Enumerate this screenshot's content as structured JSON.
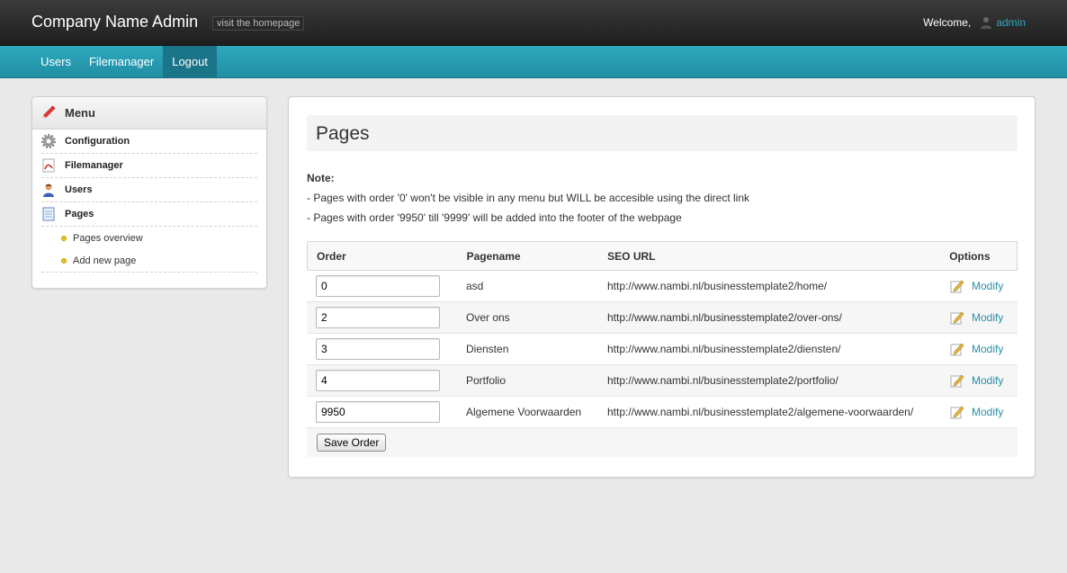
{
  "header": {
    "brand": "Company Name Admin",
    "visit_label": "visit the homepage",
    "welcome_text": "Welcome,",
    "username": "admin"
  },
  "nav": {
    "items": [
      {
        "label": "Users"
      },
      {
        "label": "Filemanager"
      },
      {
        "label": "Logout"
      }
    ]
  },
  "sidebar": {
    "title": "Menu",
    "items": [
      {
        "label": "Configuration",
        "icon": "gear-icon"
      },
      {
        "label": "Filemanager",
        "icon": "pdf-file-icon"
      },
      {
        "label": "Users",
        "icon": "user-icon"
      },
      {
        "label": "Pages",
        "icon": "page-icon"
      }
    ],
    "subitems": [
      {
        "label": "Pages overview"
      },
      {
        "label": "Add new page"
      }
    ]
  },
  "main": {
    "title": "Pages",
    "note_label": "Note:",
    "note_lines": [
      "- Pages with order '0' won't be visible in any menu but WILL be accesible using the direct link",
      "- Pages with order '9950' till '9999' will be added into the footer of the webpage"
    ],
    "table": {
      "headers": {
        "order": "Order",
        "pagename": "Pagename",
        "seo_url": "SEO URL",
        "options": "Options"
      },
      "rows": [
        {
          "order": "0",
          "pagename": "asd",
          "seo_url": "http://www.nambi.nl/businesstemplate2/home/",
          "option": "Modify"
        },
        {
          "order": "2",
          "pagename": "Over ons",
          "seo_url": "http://www.nambi.nl/businesstemplate2/over-ons/",
          "option": "Modify"
        },
        {
          "order": "3",
          "pagename": "Diensten",
          "seo_url": "http://www.nambi.nl/businesstemplate2/diensten/",
          "option": "Modify"
        },
        {
          "order": "4",
          "pagename": "Portfolio",
          "seo_url": "http://www.nambi.nl/businesstemplate2/portfolio/",
          "option": "Modify"
        },
        {
          "order": "9950",
          "pagename": "Algemene Voorwaarden",
          "seo_url": "http://www.nambi.nl/businesstemplate2/algemene-voorwaarden/",
          "option": "Modify"
        }
      ]
    },
    "save_label": "Save Order"
  },
  "colors": {
    "accent": "#2fa9bf",
    "topbar": "#2a2a2a",
    "link": "#2a8ea6"
  }
}
